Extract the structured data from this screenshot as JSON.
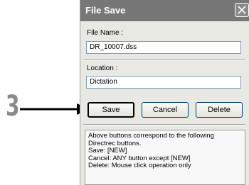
{
  "annotation": {
    "step_number": "3"
  },
  "dialog": {
    "title": "File Save",
    "file_name_label": "File Name :",
    "file_name_value": "DR_10007.dss",
    "location_label": "Location :",
    "location_value": "Dictation",
    "buttons": {
      "save": "Save",
      "cancel": "Cancel",
      "delete": "Delete"
    },
    "info_lines": [
      "Above buttons correspond to the following",
      "Directrec buttons.",
      "Save:   [NEW]",
      "Cancel: ANY button except [NEW]",
      "Delete:  Mouse click operation only"
    ]
  },
  "colors": {
    "titlebar": "#777777",
    "window_bg": "#e9e9e3",
    "arrow": "#000000",
    "step_number": "#8a8a8a"
  }
}
